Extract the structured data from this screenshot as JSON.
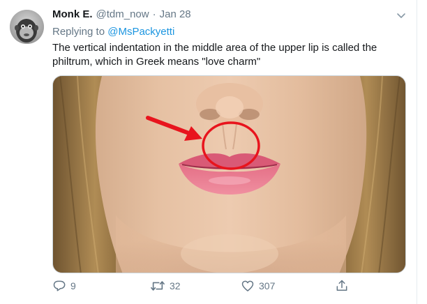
{
  "tweet": {
    "display_name": "Monk E.",
    "handle": "@tdm_now",
    "separator": "·",
    "date": "Jan 28",
    "replying_prefix": "Replying to",
    "replying_to": "@MsPackyetti",
    "text": "The vertical indentation in the middle area of the upper lip is called the philtrum, which in Greek means \"love charm\"",
    "avatar_icon": "monkey-avatar",
    "media_description_icon": "face-lips-photo"
  },
  "actions": {
    "reply_count": "9",
    "retweet_count": "32",
    "like_count": "307"
  },
  "colors": {
    "link": "#1b95e0",
    "secondary_text": "#657786",
    "annotation_red": "#e8141d"
  }
}
